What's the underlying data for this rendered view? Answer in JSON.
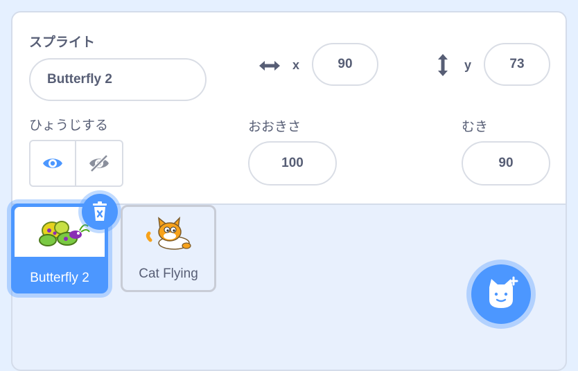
{
  "sprite_info": {
    "sprite_label": "スプライト",
    "sprite_name": "Butterfly 2",
    "x_label": "x",
    "x_value": "90",
    "y_label": "y",
    "y_value": "73",
    "show_label": "ひょうじする",
    "size_label": "おおきさ",
    "size_value": "100",
    "direction_label": "むき",
    "direction_value": "90",
    "visible": true
  },
  "sprites": [
    {
      "name": "Butterfly 2",
      "selected": true
    },
    {
      "name": "Cat Flying",
      "selected": false
    }
  ],
  "colors": {
    "accent": "#4c97ff",
    "text": "#575e75",
    "panel_bg": "#e8f0fd",
    "border": "#d9dde5"
  },
  "icons": {
    "show": "eye-icon",
    "hide": "eye-slash-icon",
    "delete": "trash-icon",
    "add": "cat-add-icon"
  }
}
